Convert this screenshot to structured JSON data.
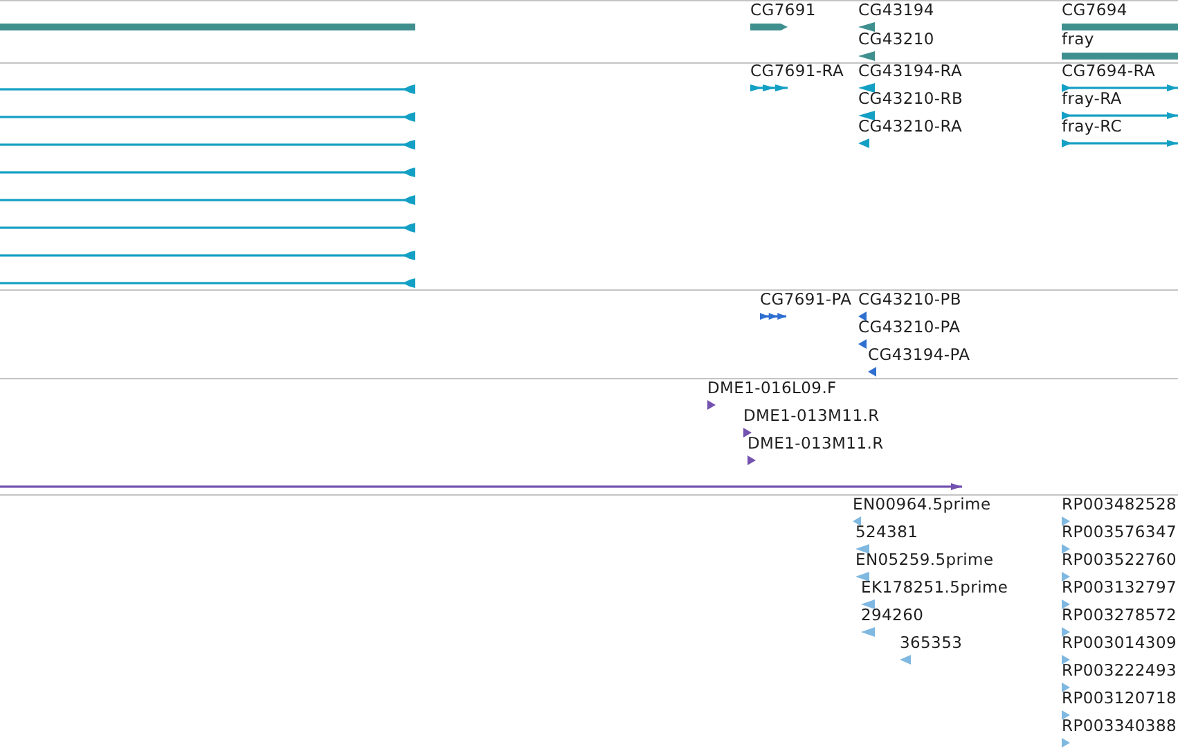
{
  "tracks": [
    {
      "color": "#3f8f8f",
      "features": [
        {
          "kind": "bar"
        },
        {
          "kind": "block",
          "forward": true,
          "label": "CG7691"
        },
        {
          "kind": "small",
          "forward": false,
          "label": "CG43194"
        },
        {
          "kind": "small",
          "forward": false,
          "label": "CG43210"
        },
        {
          "kind": "bar",
          "label": "CG7694"
        },
        {
          "kind": "bar",
          "label": "fray"
        }
      ]
    },
    {
      "color": "#14a0c4",
      "features": [
        {
          "kind": "line",
          "forward": false
        },
        {
          "kind": "line",
          "forward": false
        },
        {
          "kind": "line",
          "forward": false
        },
        {
          "kind": "line",
          "forward": false
        },
        {
          "kind": "line",
          "forward": false
        },
        {
          "kind": "line",
          "forward": false
        },
        {
          "kind": "line",
          "forward": false
        },
        {
          "kind": "line",
          "forward": false
        },
        {
          "kind": "exons",
          "forward": true,
          "label": "CG7691-RA"
        },
        {
          "kind": "small",
          "forward": false,
          "label": "CG43194-RA"
        },
        {
          "kind": "small",
          "forward": false,
          "label": "CG43210-RB"
        },
        {
          "kind": "small",
          "forward": false,
          "label": "CG43210-RA"
        },
        {
          "kind": "line",
          "forward": true,
          "label": "CG7694-RA"
        },
        {
          "kind": "line",
          "forward": true,
          "label": "fray-RA"
        },
        {
          "kind": "line",
          "forward": true,
          "label": "fray-RC"
        }
      ]
    },
    {
      "color": "#2f6fd0",
      "features": [
        {
          "kind": "exons",
          "forward": true,
          "label": "CG7691-PA"
        },
        {
          "kind": "small",
          "forward": false,
          "label": "CG43210-PB"
        },
        {
          "kind": "small",
          "forward": false,
          "label": "CG43210-PA"
        },
        {
          "kind": "small",
          "forward": false,
          "label": "CG43194-PA"
        }
      ]
    },
    {
      "color": "#7352b0",
      "features": [
        {
          "kind": "small",
          "forward": true,
          "label": "DME1-016L09.F"
        },
        {
          "kind": "small",
          "forward": true,
          "label": "DME1-013M11.R"
        },
        {
          "kind": "small",
          "forward": true,
          "label": "DME1-013M11.R"
        },
        {
          "kind": "line",
          "forward": true
        }
      ]
    },
    {
      "color": "#7fb8e0",
      "features": [
        {
          "kind": "small",
          "forward": false,
          "label": "EN00964.5prime"
        },
        {
          "kind": "small",
          "forward": false,
          "label": "524381"
        },
        {
          "kind": "small",
          "forward": false,
          "label": "EN05259.5prime"
        },
        {
          "kind": "small",
          "forward": false,
          "label": "EK178251.5prime"
        },
        {
          "kind": "small",
          "forward": false,
          "label": "294260"
        },
        {
          "kind": "small",
          "forward": false,
          "label": "365353"
        },
        {
          "kind": "small",
          "forward": true,
          "label": "RP003482528"
        },
        {
          "kind": "small",
          "forward": true,
          "label": "RP003576347"
        },
        {
          "kind": "small",
          "forward": true,
          "label": "RP003522760"
        },
        {
          "kind": "small",
          "forward": true,
          "label": "RP003132797"
        },
        {
          "kind": "small",
          "forward": true,
          "label": "RP003278572"
        },
        {
          "kind": "small",
          "forward": true,
          "label": "RP003014309"
        },
        {
          "kind": "small",
          "forward": true,
          "label": "RP003222493"
        },
        {
          "kind": "small",
          "forward": true,
          "label": "RP003120718"
        },
        {
          "kind": "small",
          "forward": true,
          "label": "RP003340388"
        }
      ]
    }
  ]
}
